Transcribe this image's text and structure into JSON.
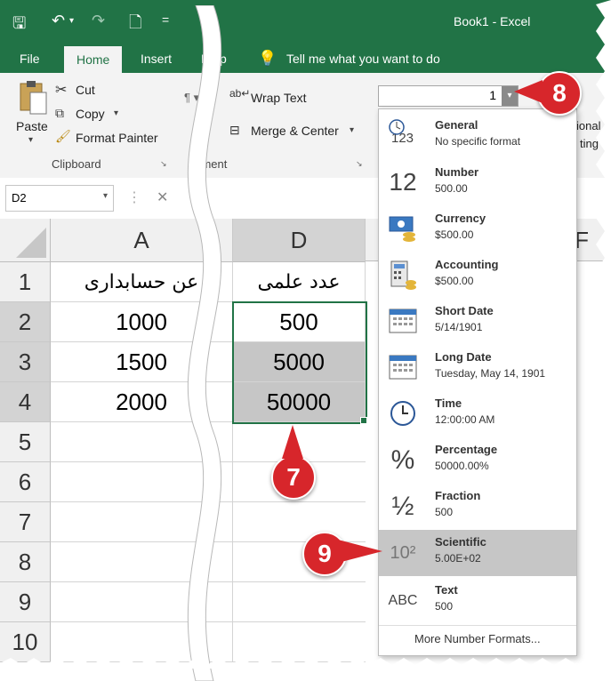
{
  "window": {
    "title": "Book1  -  Excel"
  },
  "qat": {
    "save": "🖫",
    "undo": "↶",
    "redo": "↷",
    "new": "🗋",
    "more": "="
  },
  "tabs": [
    {
      "label": "File"
    },
    {
      "label": "Home"
    },
    {
      "label": "Insert"
    },
    {
      "label": "Help"
    }
  ],
  "tellme": "Tell me what you want to do",
  "clipboard": {
    "paste": "Paste",
    "cut": "Cut",
    "copy": "Copy",
    "format_painter": "Format Painter",
    "group": "Clipboard"
  },
  "alignment": {
    "wrap": "Wrap Text",
    "merge": "Merge & Center",
    "group": "gnment"
  },
  "number": {
    "format_box_value": "1",
    "right_text_1": "ional",
    "right_text_2": "ting"
  },
  "namebox": {
    "value": "D2"
  },
  "columns": [
    "A",
    "D",
    "F"
  ],
  "rows": [
    "1",
    "2",
    "3",
    "4",
    "5",
    "6",
    "7",
    "8",
    "9",
    "10"
  ],
  "cells": {
    "A1": "عن حسابداری",
    "D1": "عدد علمی",
    "A2": "1000",
    "D2": "500",
    "A3": "1500",
    "D3": "5000",
    "A4": "2000",
    "D4": "50000"
  },
  "formats": [
    {
      "name": "General",
      "sample": "No specific format",
      "icon": "123"
    },
    {
      "name": "Number",
      "sample": "500.00",
      "icon": "12"
    },
    {
      "name": "Currency",
      "sample": "$500.00",
      "icon": "currency"
    },
    {
      "name": "Accounting",
      "sample": " $500.00",
      "icon": "accounting"
    },
    {
      "name": "Short Date",
      "sample": "5/14/1901",
      "icon": "calendar"
    },
    {
      "name": "Long Date",
      "sample": "Tuesday, May 14, 1901",
      "icon": "calendar"
    },
    {
      "name": "Time",
      "sample": "12:00:00 AM",
      "icon": "clock"
    },
    {
      "name": "Percentage",
      "sample": "50000.00%",
      "icon": "%"
    },
    {
      "name": "Fraction",
      "sample": "500",
      "icon": "½"
    },
    {
      "name": "Scientific",
      "sample": "5.00E+02",
      "icon": "10²"
    },
    {
      "name": "Text",
      "sample": "500",
      "icon": "ABC"
    }
  ],
  "more_formats": "More Number Formats...",
  "badges": {
    "seven": "7",
    "eight": "8",
    "nine": "9"
  },
  "colors": {
    "excel_green": "#217346",
    "badge_red": "#d7262b",
    "selected_item": "#c6c6c6"
  }
}
